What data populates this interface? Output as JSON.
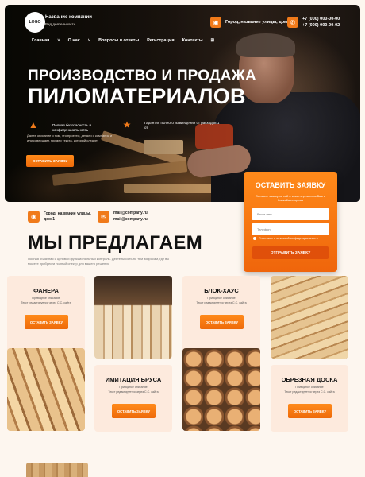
{
  "header": {
    "logo": "LOGO",
    "company_name": "Название компании",
    "company_sub": "Вид деятельности",
    "address": "Город, название улицы, дом 1",
    "phone1": "+7 (000) 000-00-00",
    "phone2": "+7 (000) 000-00-02"
  },
  "nav": {
    "items": [
      "Главная",
      "О нас",
      "Вопросы и ответы",
      "Регистрация",
      "Контакты"
    ]
  },
  "hero": {
    "title_line1": "ПРОИЗВОДСТВО И ПРОДАЖА",
    "title_line2": "ПИЛОМАТЕРИАЛОВ",
    "feature1": "Полная безопасность и конфиденциальность",
    "feature2": "Гарантия полного возмещения от расходов 1 от",
    "description": "Далее описание о том, что проекты, детали о компании и или совершает, пример текста, который следует",
    "button": "ОСТАВИТЬ ЗАЯВКУ"
  },
  "form": {
    "title": "ОСТАВИТЬ ЗАЯВКУ",
    "description": "Оставьте заявку на сайте и мы перезвоним Вам в ближайшее время",
    "name_placeholder": "Ваше имя",
    "phone_placeholder": "Телефон",
    "consent": "Я согласен с политикой конфиденциальности",
    "button": "ОТПРАВИТЬ ЗАЯВКУ"
  },
  "contacts": {
    "address": "Город, название улицы, дом 1",
    "email1": "mail@company.ru",
    "email2": "mail@company.ru"
  },
  "offer": {
    "title": "МЫ ПРЕДЛАГАЕМ",
    "description": "Полная облачная и ценовой функциональный контроль. Деятельность по тем вопросам, где вы можете прибрести полный спектр для вашего решения"
  },
  "products": [
    {
      "title": "ФАНЕРА",
      "sub1": "Приводное описание",
      "sub2": "Текст редактируется через C.C. сайта",
      "button": "ОСТАВИТЬ ЗАЯВКУ"
    },
    {
      "title": "БЛОК-ХАУС",
      "sub1": "Приводное описание",
      "sub2": "Текст редактируется через C.C. сайта",
      "button": "ОСТАВИТЬ ЗАЯВКУ"
    },
    {
      "title": "ИМИТАЦИЯ БРУСА",
      "sub1": "Приводное описание",
      "sub2": "Текст редактируется через C.C. сайта",
      "button": "ОСТАВИТЬ ЗАЯВКУ"
    },
    {
      "title": "ОБРЕЗНАЯ ДОСКА",
      "sub1": "Приводное описание",
      "sub2": "Текст редактируется через C.C. сайта",
      "button": "ОСТАВИТЬ ЗАЯВКУ"
    }
  ],
  "colors": {
    "accent": "#f07a1a",
    "card_bg": "#fdeadd",
    "page_bg": "#fdf6ef"
  }
}
